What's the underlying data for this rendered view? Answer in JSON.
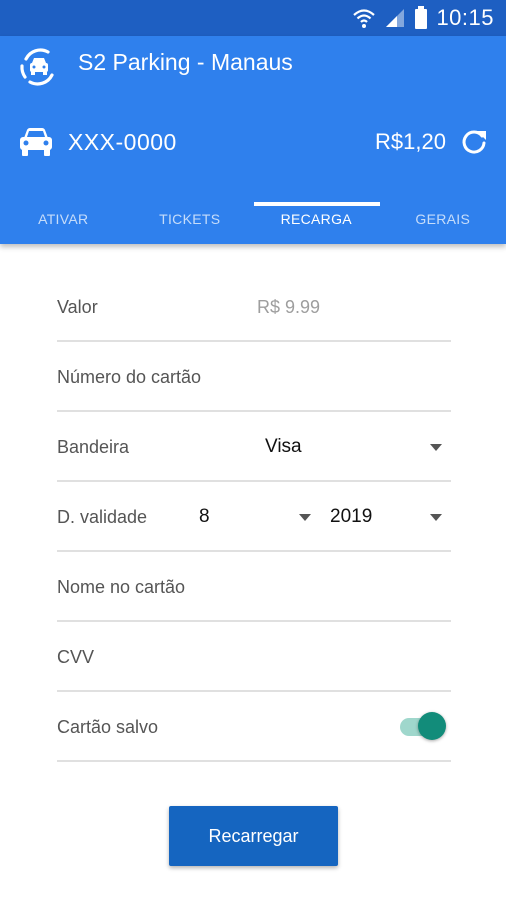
{
  "status_bar": {
    "time": "10:15",
    "icons": [
      "wifi-icon",
      "signal-icon",
      "battery-icon"
    ]
  },
  "app": {
    "title": "S2 Parking - Manaus",
    "plate": "XXX-0000",
    "balance": "R$1,20"
  },
  "tabs": [
    {
      "label": "ATIVAR",
      "active": false
    },
    {
      "label": "TICKETS",
      "active": false
    },
    {
      "label": "RECARGA",
      "active": true
    },
    {
      "label": "GERAIS",
      "active": false
    }
  ],
  "form": {
    "valor_label": "Valor",
    "valor_placeholder": "R$ 9.99",
    "numero_label": "Número do cartão",
    "bandeira_label": "Bandeira",
    "bandeira_value": "Visa",
    "validade_label": "D. validade",
    "validade_month": "8",
    "validade_year": "2019",
    "nome_label": "Nome no cartão",
    "cvv_label": "CVV",
    "salvo_label": "Cartão salvo",
    "salvo_on": true
  },
  "button": {
    "label": "Recarregar"
  },
  "colors": {
    "status_bar": "#1e5fc2",
    "app_bar": "#2f80ed",
    "button": "#1565c0",
    "toggle_on": "#128c7a"
  }
}
